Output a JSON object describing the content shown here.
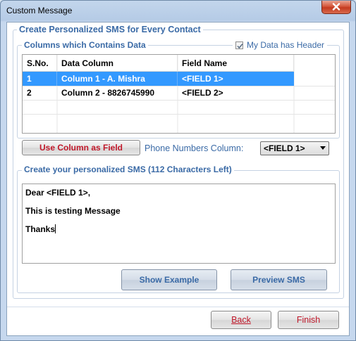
{
  "window": {
    "title": "Custom Message"
  },
  "main_group": {
    "legend": "Create Personalized SMS for Every Contact"
  },
  "columns_group": {
    "legend": "Columns which Contains Data",
    "header_checkbox_label": "My Data has Header",
    "header_checked": true
  },
  "grid": {
    "headers": [
      "S.No.",
      "Data Column",
      "Field Name"
    ],
    "rows": [
      {
        "sno": "1",
        "data_column": "Column 1 - A. Mishra",
        "field_name": "<FIELD 1>",
        "selected": true
      },
      {
        "sno": "2",
        "data_column": "Column 2 - 8826745990",
        "field_name": "<FIELD 2>",
        "selected": false
      }
    ]
  },
  "controls": {
    "use_column_label": "Use Column as Field",
    "phone_label": "Phone Numbers Column:",
    "phone_value": "<FIELD 1>"
  },
  "sms_group": {
    "legend": "Create your personalized SMS (112 Characters Left)",
    "lines": [
      "Dear <FIELD 1>,",
      "This is testing Message",
      "Thanks"
    ]
  },
  "buttons": {
    "show_example": "Show Example",
    "preview_sms": "Preview SMS",
    "back": "Back",
    "finish": "Finish"
  },
  "colors": {
    "accent": "#3a6aa6",
    "action_red": "#c0182a",
    "selection": "#3399ff"
  }
}
